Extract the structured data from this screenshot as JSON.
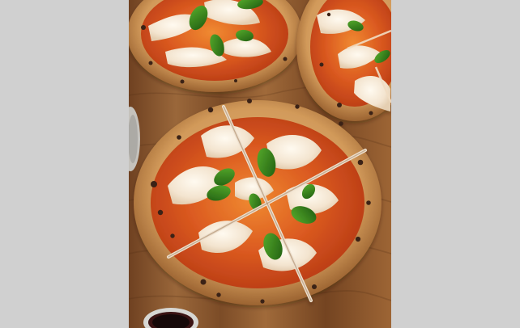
{
  "image": {
    "subject": "pizza",
    "colors": {
      "page_background": "#d0d0d0",
      "wood": "#8a5730",
      "wood_dark": "#5f361a",
      "crust": "#d7a56a",
      "crust_shadow": "#9a6633",
      "sauce": "#d84b1d",
      "cheese": "#f6eadb",
      "basil": "#2f7d16",
      "char": "#3a2418"
    },
    "elements": [
      "wooden-board",
      "top-left-pizza",
      "top-right-pizza",
      "main-sliced-pizza",
      "basil-leaves",
      "dipping-bowl"
    ]
  }
}
